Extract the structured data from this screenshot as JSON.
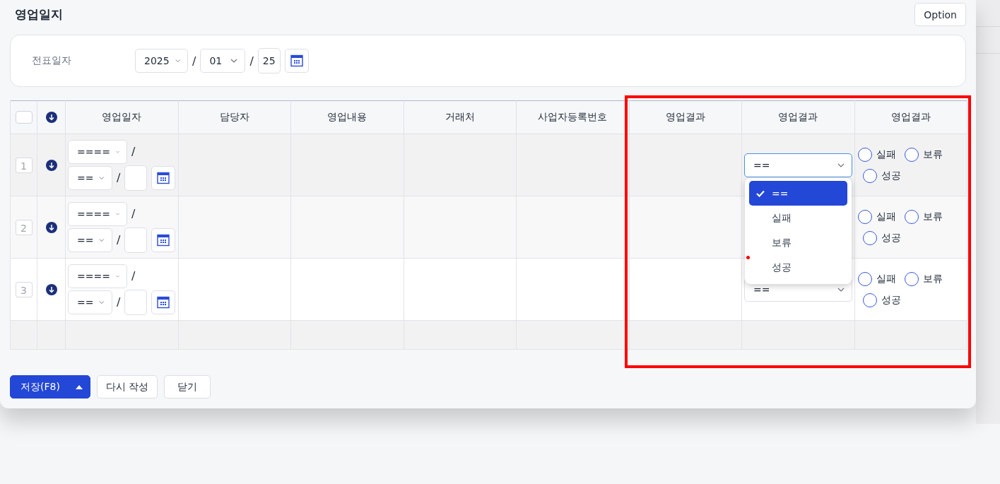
{
  "title": "영업일지",
  "option_button": "Option",
  "header_form": {
    "label": "전표일자",
    "year": "2025",
    "separators": [
      "/",
      "/"
    ],
    "month": "01",
    "day": "25"
  },
  "table": {
    "header_checkbox": {
      "checked": false
    },
    "columns": [
      "영업일자",
      "담당자",
      "영업내용",
      "거래처",
      "사업자등록번호",
      "영업결과",
      "영업결과",
      "영업결과"
    ],
    "rows": [
      {
        "number": "1",
        "year": "====",
        "separators": [
          "/",
          "/"
        ],
        "month": "==",
        "result_select": {
          "value": "==",
          "focused": true,
          "options": [
            {
              "label": "==",
              "selected": true
            },
            {
              "label": "실패",
              "selected": false
            },
            {
              "label": "보류",
              "selected": false
            },
            {
              "label": "성공",
              "selected": false
            }
          ]
        },
        "result_radios": [
          {
            "label": "실패",
            "selected": false
          },
          {
            "label": "보류",
            "selected": false
          },
          {
            "label": "성공",
            "selected": false
          }
        ]
      },
      {
        "number": "2",
        "year": "====",
        "separators": [
          "/",
          "/"
        ],
        "month": "==",
        "result_radios": [
          {
            "label": "실패",
            "selected": false
          },
          {
            "label": "보류",
            "selected": false
          },
          {
            "label": "성공",
            "selected": false
          }
        ]
      },
      {
        "number": "3",
        "year": "====",
        "separators": [
          "/",
          "/"
        ],
        "month": "==",
        "result_select": {
          "value": "==",
          "focused": false
        },
        "result_radios": [
          {
            "label": "실패",
            "selected": false
          },
          {
            "label": "보류",
            "selected": false
          },
          {
            "label": "성공",
            "selected": false
          }
        ]
      }
    ]
  },
  "buttons": {
    "save": "저장(F8)",
    "rewrite": "다시 작성",
    "close": "닫기"
  }
}
